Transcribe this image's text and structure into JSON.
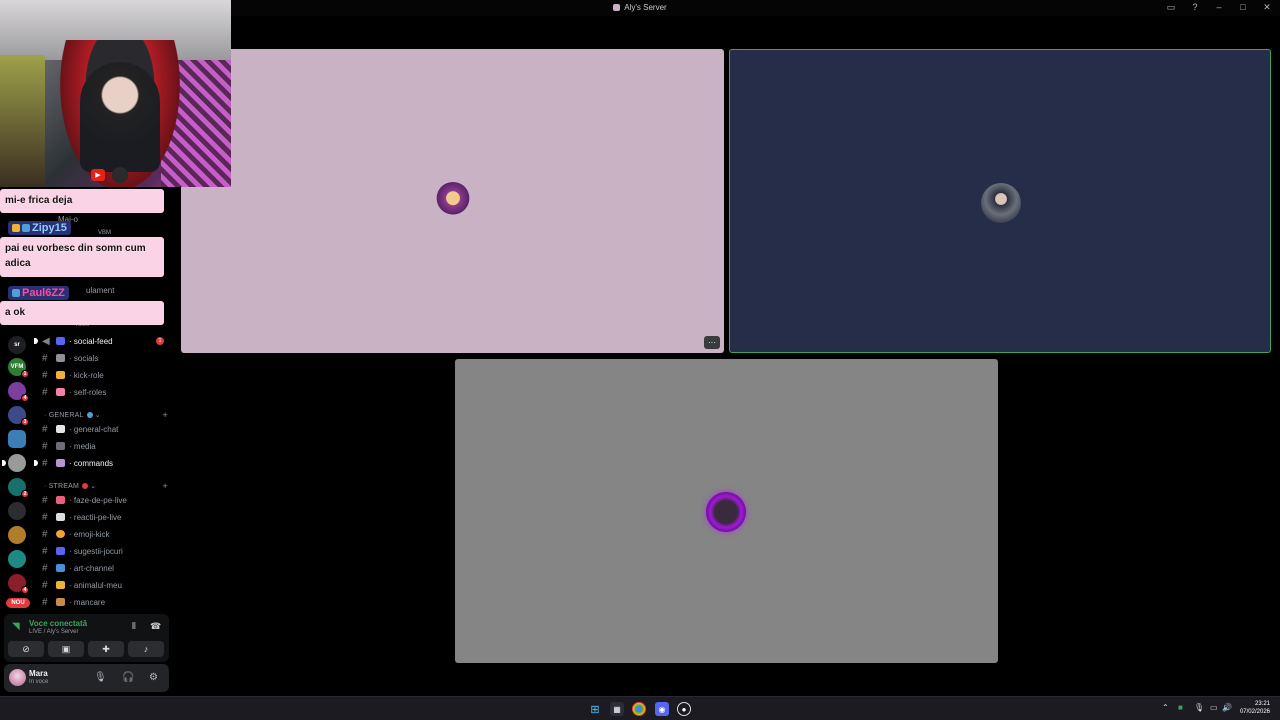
{
  "window": {
    "title": "Aly's Server"
  },
  "overlay": {
    "chat": [
      {
        "text": "mi-e frica deja"
      },
      {
        "name": "Zipy15",
        "text": "pai eu vorbesc din somn cum adica"
      },
      {
        "name": "Paul6ZZ",
        "text": "a ok"
      }
    ]
  },
  "guilds": [
    {
      "label": "sr"
    },
    {
      "label": "VFM",
      "badge": "1"
    },
    {
      "label": "",
      "badge": "4"
    },
    {
      "label": "",
      "badge": "3"
    },
    {
      "label": "",
      "badge": ""
    },
    {
      "label": "",
      "badge": ""
    },
    {
      "label": "",
      "badge": "2"
    },
    {
      "label": "",
      "badge": ""
    },
    {
      "label": "",
      "badge": ""
    },
    {
      "label": "",
      "badge": ""
    },
    {
      "label": "",
      "badge": "4"
    }
  ],
  "guild_new": "NOU",
  "channels": {
    "partial": {
      "user1": "Mai-o",
      "user2": "VBM",
      "item": "ulament",
      "roles": "roles"
    },
    "top": [
      {
        "name": "social-feed",
        "bold": true,
        "unread": "1",
        "prefix": "·"
      },
      {
        "name": "socials",
        "prefix": "·"
      },
      {
        "name": "kick-role",
        "prefix": "·"
      },
      {
        "name": "self-roles",
        "prefix": "·"
      }
    ],
    "cat_general": "GENERAL",
    "general": [
      {
        "name": "general-chat",
        "prefix": "·"
      },
      {
        "name": "media",
        "prefix": "·"
      },
      {
        "name": "commands",
        "bold": true,
        "prefix": "·"
      }
    ],
    "cat_stream": "STREAM",
    "stream": [
      {
        "name": "faze-de-pe-live",
        "prefix": "·"
      },
      {
        "name": "reactii-pe-live",
        "prefix": "·"
      },
      {
        "name": "emoji-kick",
        "prefix": "·"
      },
      {
        "name": "sugestii-jocuri",
        "prefix": "·"
      },
      {
        "name": "art-channel",
        "prefix": "·"
      },
      {
        "name": "animalul-meu",
        "prefix": "·"
      },
      {
        "name": "mancare",
        "prefix": "·"
      }
    ]
  },
  "voice": {
    "status": "Voce conectată",
    "sub": "LIVE / Aly's Server"
  },
  "user": {
    "name": "Mara",
    "status": "In voce"
  },
  "taskbar": {
    "time": "23:21",
    "date": "07/02/2026"
  },
  "colors": {
    "accent_green": "#3ba55c",
    "unread_red": "#e03b3f",
    "chat_bubble": "#fbd3e6"
  }
}
